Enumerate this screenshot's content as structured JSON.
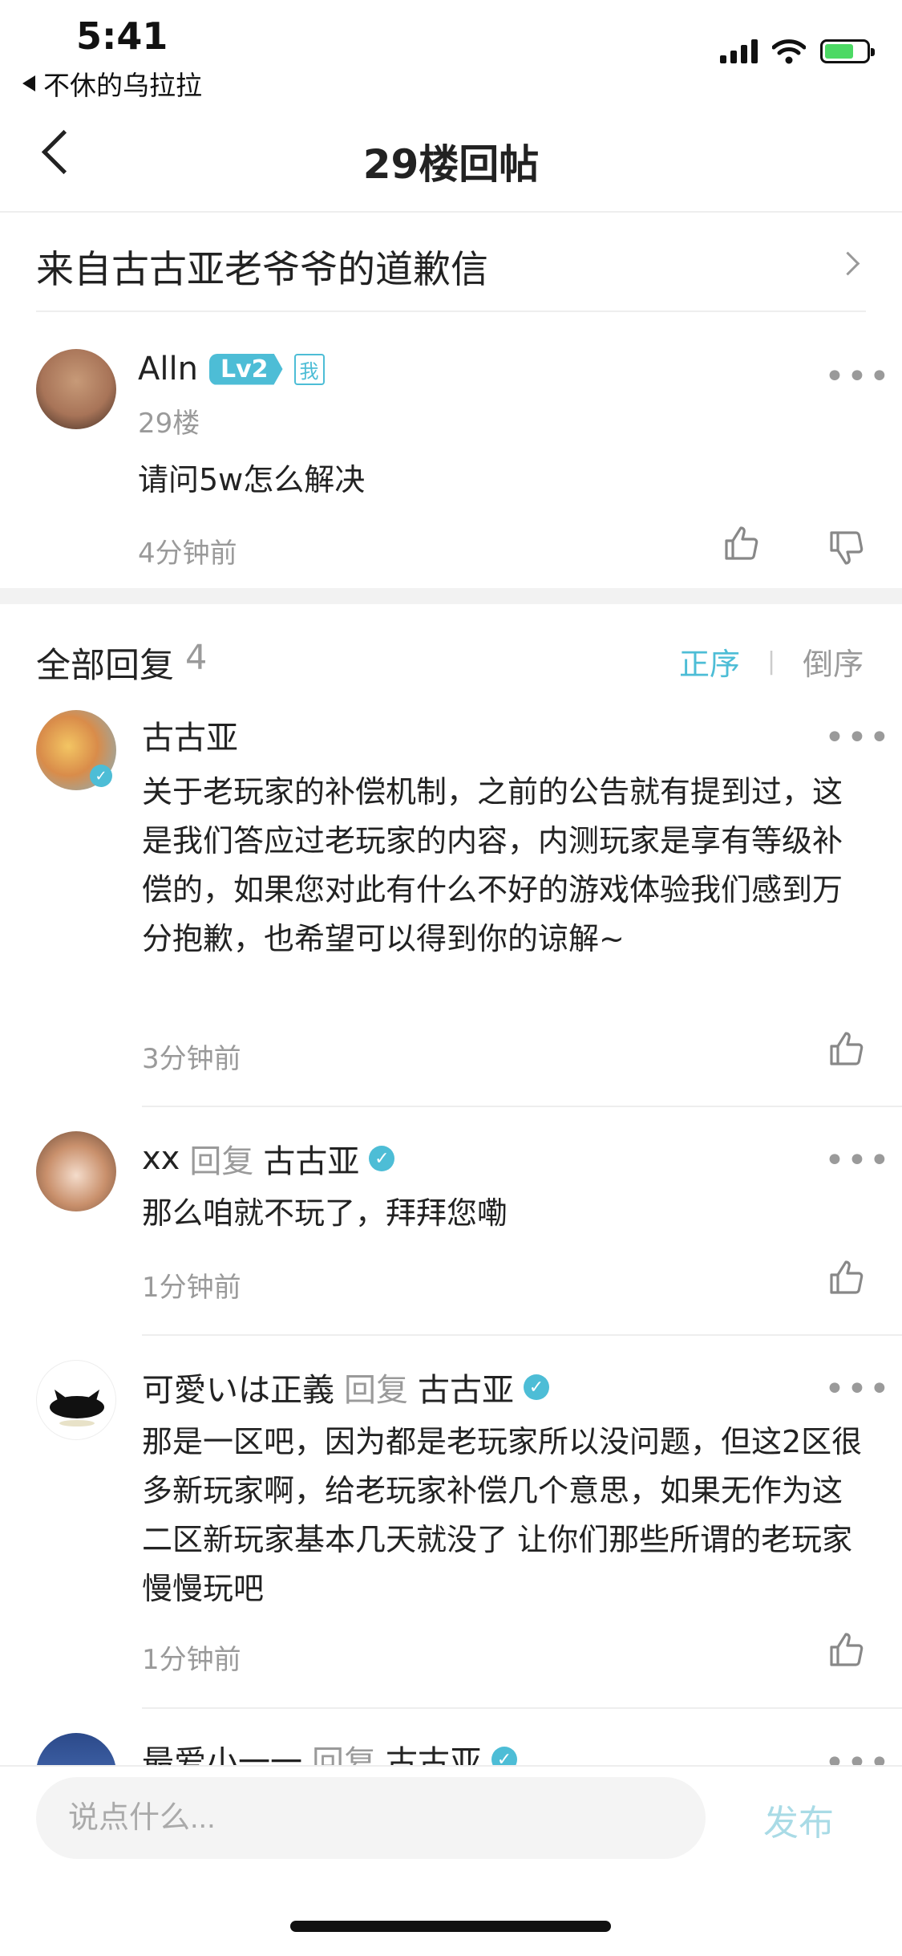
{
  "status_bar": {
    "time": "5:41",
    "back_app": "不休的乌拉拉"
  },
  "nav": {
    "title": "29楼回帖"
  },
  "post_link": {
    "label": "来自古古亚老爷爷的道歉信"
  },
  "floor_post": {
    "username": "Alln",
    "level": "Lv2",
    "me_tag": "我",
    "floor": "29楼",
    "content": "请问5w怎么解决",
    "time": "4分钟前"
  },
  "replies_header": {
    "title": "全部回复",
    "count": "4",
    "sort_asc": "正序",
    "sort_sep": "|",
    "sort_desc": "倒序"
  },
  "replies": [
    {
      "username": "古古亚",
      "content": "关于老玩家的补偿机制，之前的公告就有提到过，这是我们答应过老玩家的内容，内测玩家是享有等级补偿的，如果您对此有什么不好的游戏体验我们感到万分抱歉，也希望可以得到你的谅解~",
      "time": "3分钟前"
    },
    {
      "username": "xx",
      "reply_word": "回复",
      "reply_to": "古古亚",
      "content": "那么咱就不玩了，拜拜您嘞",
      "time": "1分钟前"
    },
    {
      "username": "可愛いは正義",
      "reply_word": "回复",
      "reply_to": "古古亚",
      "content": "那是一区吧，因为都是老玩家所以没问题，但这2区很多新玩家啊，给老玩家补偿几个意思，如果无作为这二区新玩家基本几天就没了 让你们那些所谓的老玩家慢慢玩吧",
      "time": "1分钟前"
    },
    {
      "username": "最爱小一一",
      "reply_word": "回复",
      "reply_to": "古古亚"
    }
  ],
  "bottom_bar": {
    "placeholder": "说点什么...",
    "publish": "发布"
  },
  "colors": {
    "accent": "#4dbdd6",
    "muted": "#9a9a9a",
    "publish_disabled": "#a9dbe6"
  },
  "icons": [
    "back-icon",
    "chevron-right-icon",
    "more-icon",
    "thumbs-up-icon",
    "thumbs-down-icon",
    "verified-icon",
    "wifi-icon",
    "signal-icon",
    "battery-icon"
  ]
}
